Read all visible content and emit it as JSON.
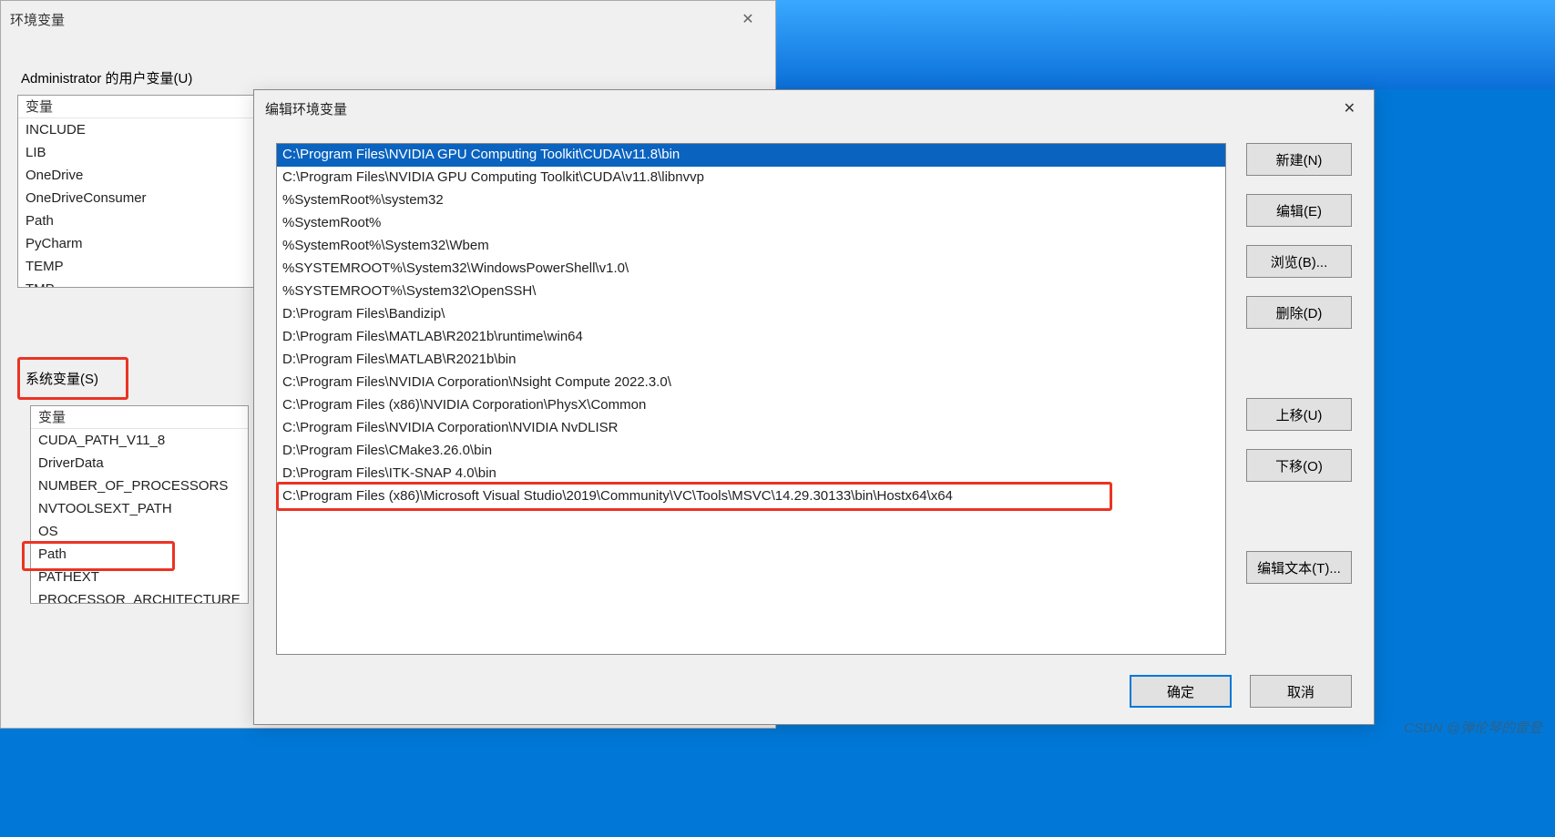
{
  "env_dialog": {
    "title": "环境变量",
    "close_glyph": "✕",
    "user_section_label": "Administrator 的用户变量(U)",
    "user_header": "变量",
    "user_vars": [
      "INCLUDE",
      "LIB",
      "OneDrive",
      "OneDriveConsumer",
      "Path",
      "PyCharm",
      "TEMP",
      "TMP"
    ],
    "sys_section_label": "系统变量(S)",
    "sys_header": "变量",
    "sys_vars": [
      "CUDA_PATH_V11_8",
      "DriverData",
      "NUMBER_OF_PROCESSORS",
      "NVTOOLSEXT_PATH",
      "OS",
      "Path",
      "PATHEXT",
      "PROCESSOR_ARCHITECTURE"
    ]
  },
  "edit_dialog": {
    "title": "编辑环境变量",
    "close_glyph": "✕",
    "paths": [
      "C:\\Program Files\\NVIDIA GPU Computing Toolkit\\CUDA\\v11.8\\bin",
      "C:\\Program Files\\NVIDIA GPU Computing Toolkit\\CUDA\\v11.8\\libnvvp",
      "%SystemRoot%\\system32",
      "%SystemRoot%",
      "%SystemRoot%\\System32\\Wbem",
      "%SYSTEMROOT%\\System32\\WindowsPowerShell\\v1.0\\",
      "%SYSTEMROOT%\\System32\\OpenSSH\\",
      "D:\\Program Files\\Bandizip\\",
      "D:\\Program Files\\MATLAB\\R2021b\\runtime\\win64",
      "D:\\Program Files\\MATLAB\\R2021b\\bin",
      "C:\\Program Files\\NVIDIA Corporation\\Nsight Compute 2022.3.0\\",
      "C:\\Program Files (x86)\\NVIDIA Corporation\\PhysX\\Common",
      "C:\\Program Files\\NVIDIA Corporation\\NVIDIA NvDLISR",
      "D:\\Program Files\\CMake3.26.0\\bin",
      "D:\\Program Files\\ITK-SNAP 4.0\\bin",
      "C:\\Program Files (x86)\\Microsoft Visual Studio\\2019\\Community\\VC\\Tools\\MSVC\\14.29.30133\\bin\\Hostx64\\x64"
    ],
    "selected_index": 0,
    "buttons": {
      "new": "新建(N)",
      "edit": "编辑(E)",
      "browse": "浏览(B)...",
      "delete": "删除(D)",
      "up": "上移(U)",
      "down": "下移(O)",
      "edit_text": "编辑文本(T)...",
      "ok": "确定",
      "cancel": "取消"
    }
  },
  "watermark": "CSDN @弹伦琴的雷登"
}
